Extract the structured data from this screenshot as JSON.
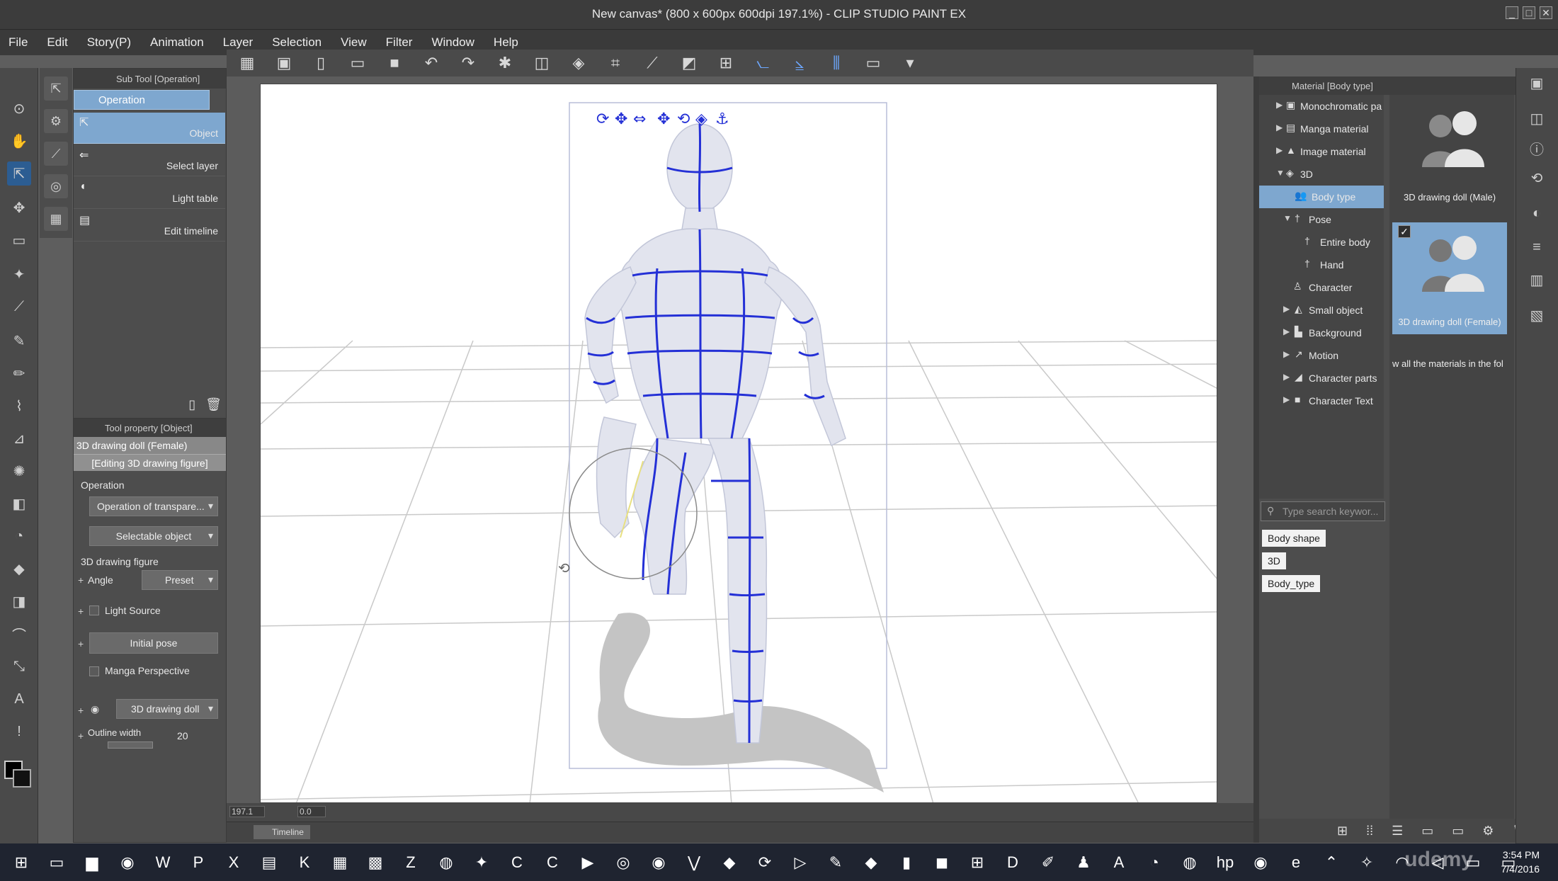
{
  "window": {
    "title": "New canvas* (800 x 600px 600dpi 197.1%)  - CLIP STUDIO PAINT EX",
    "controls": [
      "_",
      "□",
      "✕"
    ]
  },
  "menu": [
    "File",
    "Edit",
    "Story(P)",
    "Animation",
    "Layer",
    "Selection",
    "View",
    "Filter",
    "Window",
    "Help"
  ],
  "command_bar": [
    "grid-icon",
    "material-icon",
    "new-icon",
    "open-icon",
    "save-icon",
    "undo-icon",
    "redo-icon",
    "clear-icon",
    "fill-icon",
    "erase-icon",
    "crop-icon",
    "transform-icon",
    "ruler-icon",
    "snap-icon",
    "snap-special-icon",
    "snap-grid-icon",
    "monitor-icon",
    "dropdown-icon"
  ],
  "sub_tool": {
    "header": "Sub Tool [Operation]",
    "group": "Operation",
    "items": [
      "Object",
      "Select layer",
      "Light table",
      "Edit timeline"
    ]
  },
  "tool_property": {
    "header": "Tool property [Object]",
    "name": "3D drawing doll (Female)",
    "editing": "[Editing 3D drawing figure]",
    "operation_label": "Operation",
    "operation_mode": "Operation of transpare...",
    "selectable": "Selectable object",
    "figure_label": "3D drawing figure",
    "angle_label": "Angle",
    "preset_label": "Preset",
    "light_source": "Light Source",
    "initial_pose": "Initial pose",
    "manga_perspective": "Manga Perspective",
    "doll_select": "3D drawing doll",
    "outline_label": "Outline width",
    "outline_value": "20"
  },
  "status": {
    "zoom": "197.1",
    "rotation": "0.0",
    "timeline_tab": "Timeline"
  },
  "material": {
    "header": "Material [Body type]",
    "tree": [
      {
        "label": "Monochromatic pa",
        "indent": 0
      },
      {
        "label": "Manga material",
        "indent": 0
      },
      {
        "label": "Image material",
        "indent": 0
      },
      {
        "label": "3D",
        "indent": 0
      },
      {
        "label": "Body type",
        "indent": 1
      },
      {
        "label": "Pose",
        "indent": 1
      },
      {
        "label": "Entire body",
        "indent": 2
      },
      {
        "label": "Hand",
        "indent": 2
      },
      {
        "label": "Character",
        "indent": 1
      },
      {
        "label": "Small object",
        "indent": 1
      },
      {
        "label": "Background",
        "indent": 1
      },
      {
        "label": "Motion",
        "indent": 1
      },
      {
        "label": "Character parts",
        "indent": 1
      },
      {
        "label": "Character Text",
        "indent": 1
      }
    ],
    "search_placeholder": "Type search keywor...",
    "tags": [
      "Body shape",
      "3D",
      "Body_type"
    ],
    "cards": [
      "3D drawing doll (Male)",
      "3D drawing doll (Female)"
    ],
    "description": "w all the materials in the fol"
  },
  "taskbar": {
    "time": "3:54 PM",
    "date": "7/4/2016",
    "watermark": "udemy"
  },
  "colors": {
    "selection": "#7ea7cf",
    "wireframe": "#2430d6",
    "panel": "#4d4d4d"
  }
}
